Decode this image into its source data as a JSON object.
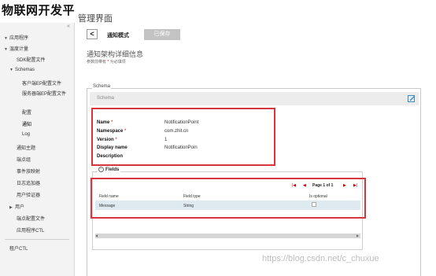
{
  "app": {
    "brand": "物联网开发平",
    "page_title": "管理界面"
  },
  "sidebar": {
    "collapse_icon": "«",
    "items": [
      {
        "label": "应用程序",
        "chev": "▼"
      },
      {
        "label": "温度计量",
        "chev": "▼"
      },
      {
        "label": "SDK配置文件",
        "chev": ""
      },
      {
        "label": "Schemas",
        "chev": "▼"
      },
      {
        "label": "客户端EP配置文件",
        "chev": ""
      },
      {
        "label": "服务器端EP配置文件",
        "chev": ""
      },
      {
        "label": "配置",
        "chev": ""
      },
      {
        "label": "通知",
        "chev": ""
      },
      {
        "label": "Log",
        "chev": ""
      },
      {
        "label": "通知主题",
        "chev": ""
      },
      {
        "label": "端点组",
        "chev": ""
      },
      {
        "label": "事件族映射",
        "chev": ""
      },
      {
        "label": "日志追加器",
        "chev": ""
      },
      {
        "label": "用户验证器",
        "chev": ""
      },
      {
        "label": "用户",
        "chev": "▶"
      },
      {
        "label": "端点配置文件",
        "chev": ""
      },
      {
        "label": "应用程序CTL",
        "chev": ""
      },
      {
        "label": "租户CTL",
        "chev": ""
      }
    ]
  },
  "toolbar": {
    "back_label": "<",
    "mode_title": "通知模式",
    "save_label": "已保存"
  },
  "section": {
    "title": "通知架构详细信息",
    "note_prefix": "参数前带有",
    "note_mark": "*",
    "note_suffix": "为必填项"
  },
  "schema": {
    "legend": "Schema",
    "bar_label": "Schema",
    "fields": [
      {
        "label": "Name",
        "required": "*",
        "value": "NotificationPoint"
      },
      {
        "label": "Namespace",
        "required": "*",
        "value": "com.zhit.cn"
      },
      {
        "label": "Version",
        "required": "*",
        "value": "1"
      },
      {
        "label": "Display name",
        "required": "",
        "value": "NotificationPoin"
      },
      {
        "label": "Description",
        "required": "",
        "value": ""
      }
    ]
  },
  "fields_panel": {
    "toggle_icon": "−",
    "title": "Fields",
    "pager": {
      "first": "|◀",
      "prev": "◀",
      "text": "Page 1 of 1",
      "next": "▶",
      "last": "▶|"
    },
    "columns": [
      "Field name",
      "Field type",
      "Is optional"
    ],
    "rows": [
      {
        "name": "Message",
        "type": "String",
        "optional": false
      }
    ]
  },
  "watermark": "https://blog.csdn.net/c_chuxue",
  "colors": {
    "highlight": "#d9353c",
    "accent_icon": "#3a8dc9",
    "row_bg": "#dfeaf0"
  }
}
